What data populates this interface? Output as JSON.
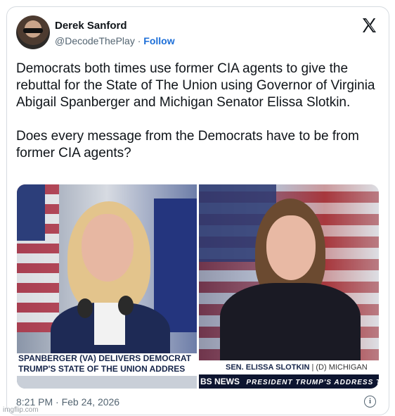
{
  "author": {
    "name": "Derek Sanford",
    "handle": "@DecodeThePlay",
    "separator": "·",
    "follow_label": "Follow"
  },
  "tweet": {
    "text": "Democrats both times use former CIA agents to give the rebuttal for the State of The Union using Governor of Virginia Abigail Spanberger and Michigan Senator Elissa Slotkin.\n\nDoes every message from the Democrats have to be from former CIA agents?"
  },
  "media": {
    "left_chyron_line1": "SPANBERGER (VA) DELIVERS DEMOCRAT",
    "left_chyron_line2": "TRUMP'S STATE OF THE UNION ADDRES",
    "right_lower_third_name": "SEN. ELISSA SLOTKIN",
    "right_lower_third_party": "| (D) MICHIGAN",
    "right_network": "BS NEWS",
    "right_ticker": "PRESIDENT TRUMP'S ADDRESS TO CO"
  },
  "footer": {
    "timestamp": "8:21 PM · Feb 24, 2026",
    "info_glyph": "i"
  },
  "watermark": "imgflip.com",
  "icons": [
    "x-logo-icon",
    "info-icon"
  ]
}
